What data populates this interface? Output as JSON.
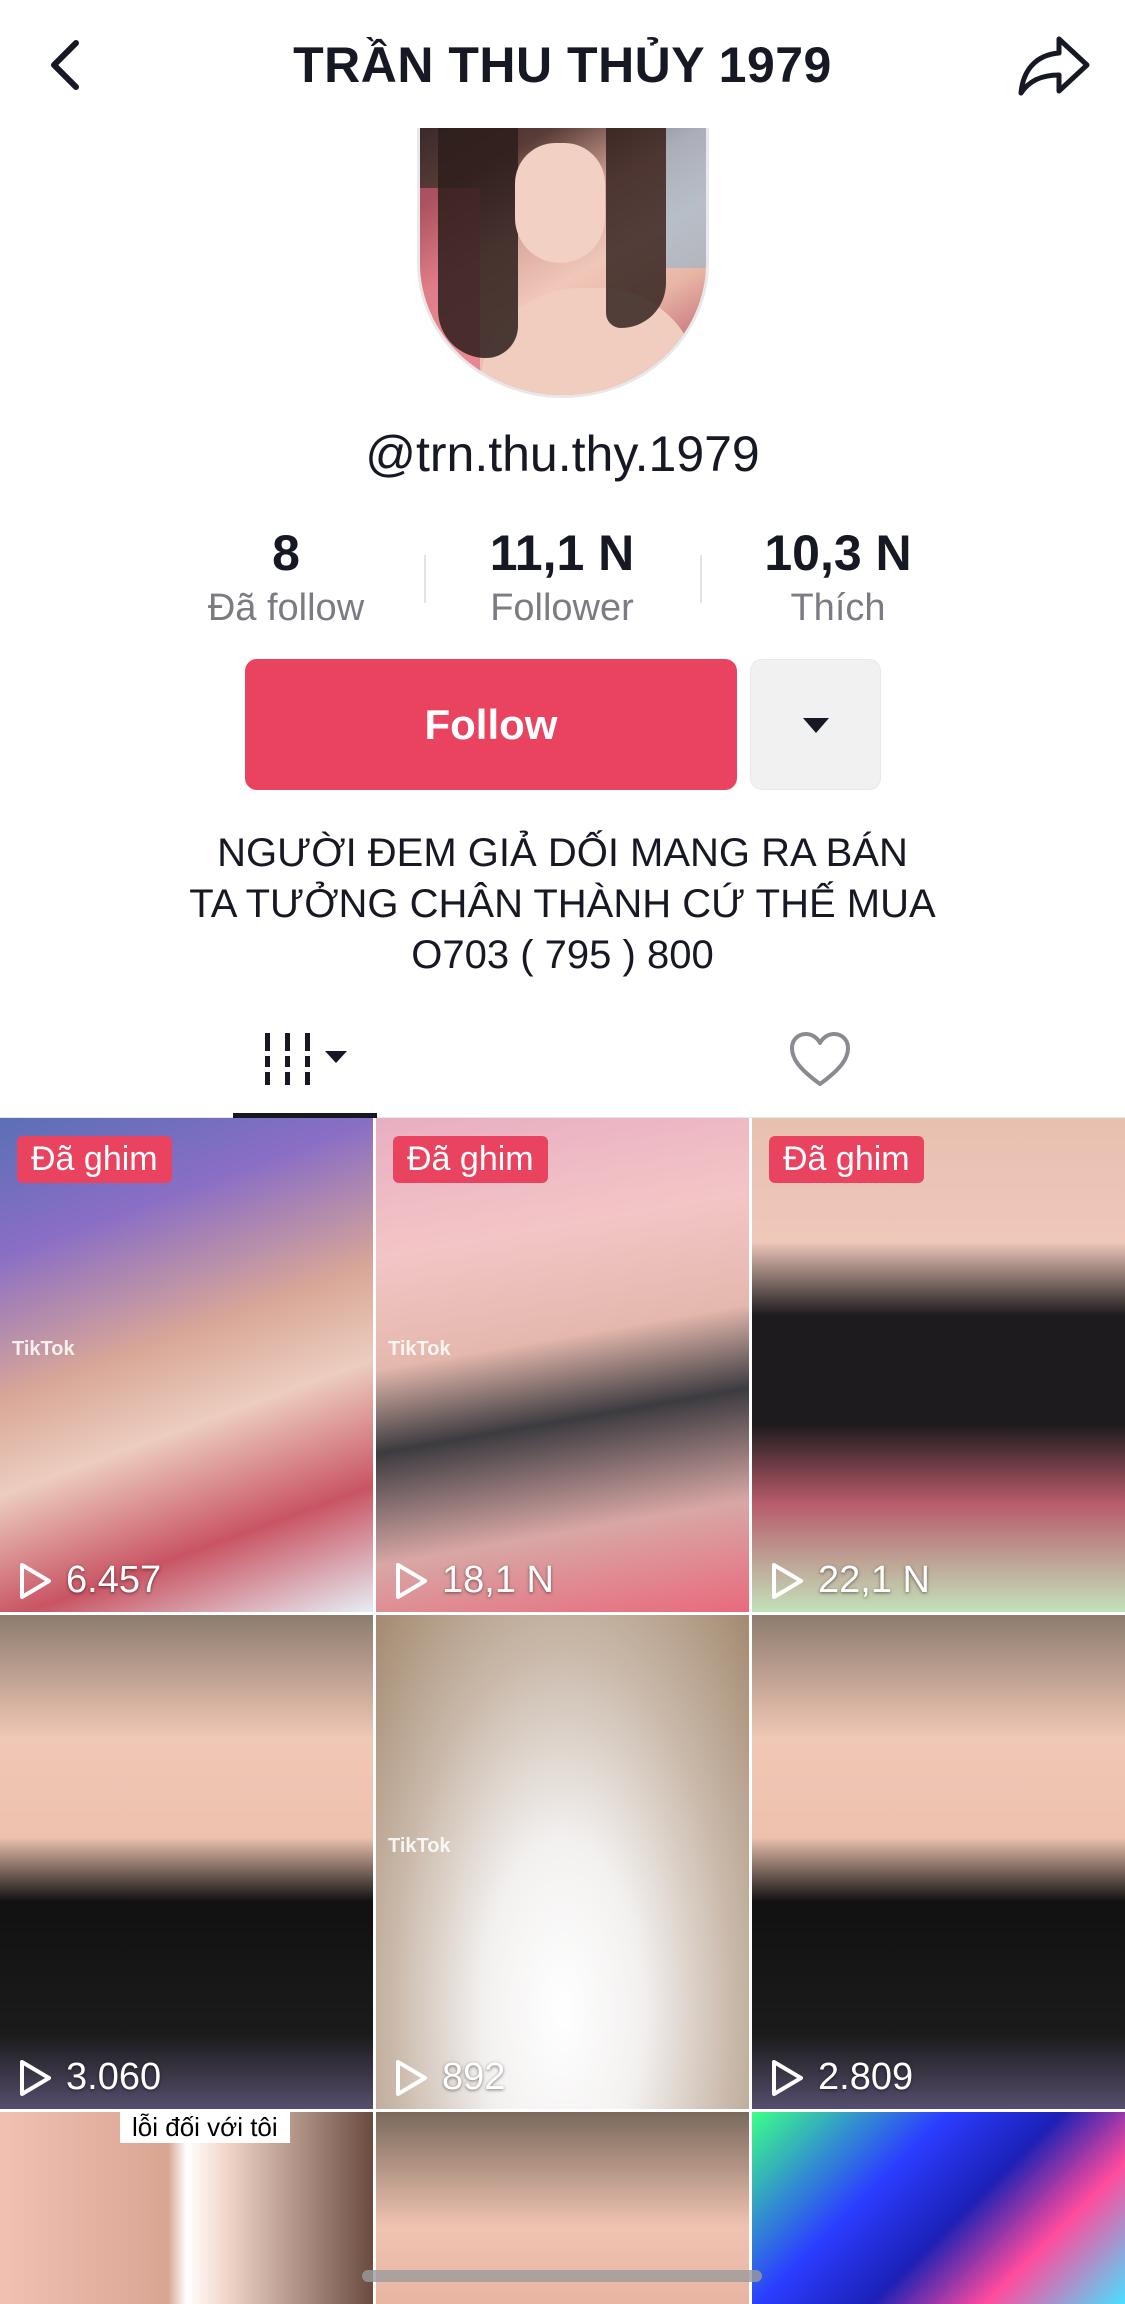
{
  "header": {
    "title": "TRẦN THU THỦY 1979"
  },
  "profile": {
    "username": "@trn.thu.thy.1979",
    "stats": [
      {
        "value": "8",
        "label": "Đã follow"
      },
      {
        "value": "11,1 N",
        "label": "Follower"
      },
      {
        "value": "10,3 N",
        "label": "Thích"
      }
    ],
    "follow_label": "Follow",
    "bio": [
      "NGƯỜI ĐEM GIẢ DỐI MANG RA BÁN",
      "TA TƯỞNG CHÂN THÀNH CỨ THẾ MUA",
      "O703 ( 795 ) 800"
    ]
  },
  "colors": {
    "accent": "#ea435f",
    "muted_text": "#7a7b83"
  },
  "videos": [
    {
      "pinned": "Đã ghim",
      "views": "6.457",
      "watermark": "TikTok"
    },
    {
      "pinned": "Đã ghim",
      "views": "18,1 N",
      "watermark": "TikTok"
    },
    {
      "pinned": "Đã ghim",
      "views": "22,1 N",
      "watermark": ""
    },
    {
      "pinned": "",
      "views": "3.060",
      "watermark": ""
    },
    {
      "pinned": "",
      "views": "892",
      "watermark": "TikTok"
    },
    {
      "pinned": "",
      "views": "2.809",
      "watermark": ""
    },
    {
      "pinned": "",
      "views": "",
      "caption": "lỗi đối với tôi"
    },
    {
      "pinned": "",
      "views": ""
    },
    {
      "pinned": "",
      "views": ""
    }
  ]
}
